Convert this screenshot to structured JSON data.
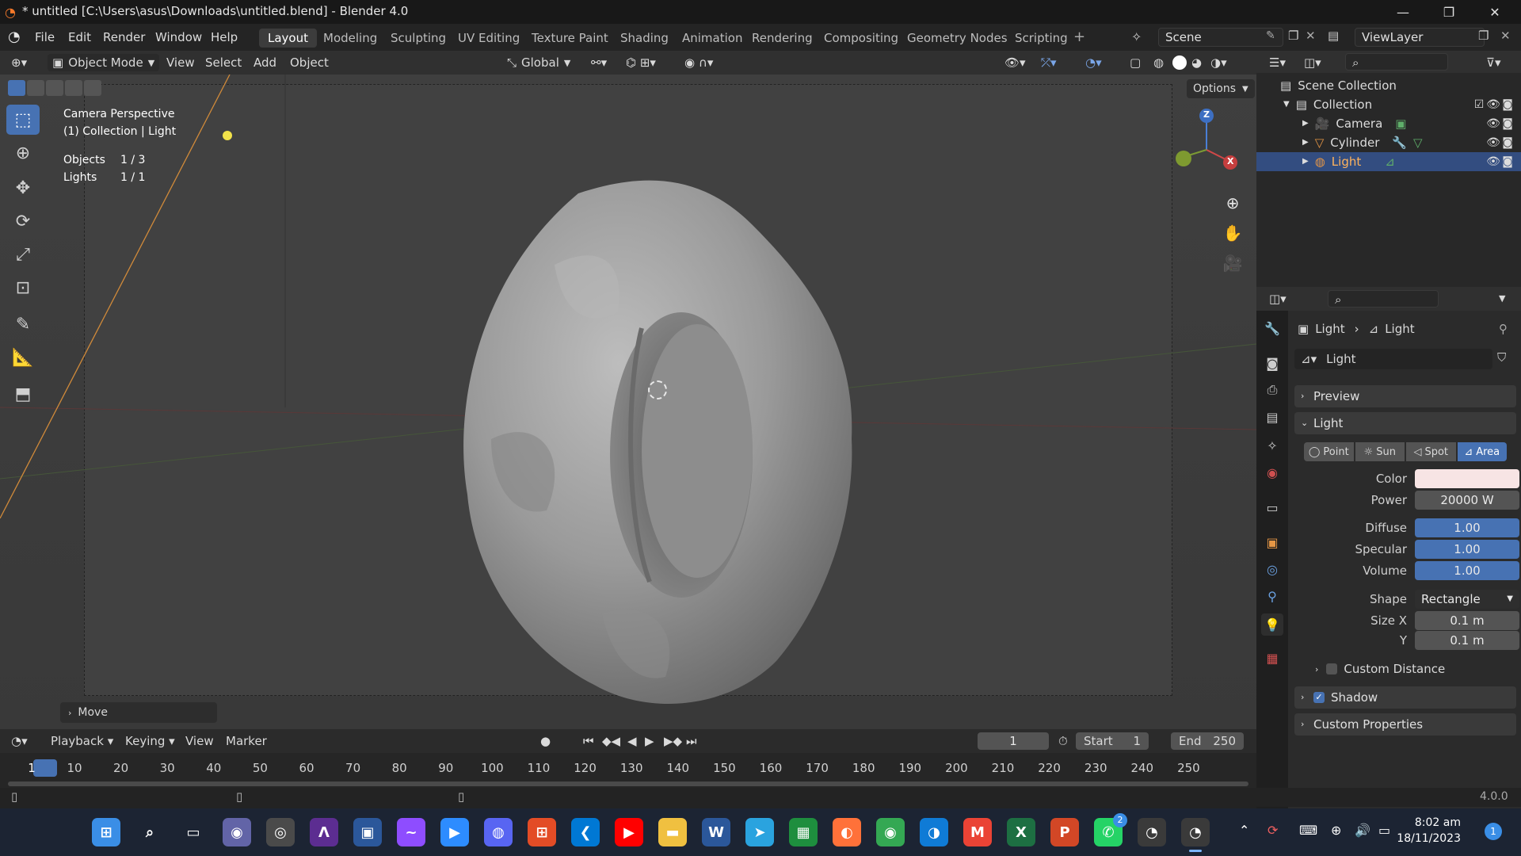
{
  "window": {
    "title": "* untitled [C:\\Users\\asus\\Downloads\\untitled.blend] - Blender 4.0",
    "minimize": "—",
    "maximize": "❐",
    "close": "✕"
  },
  "menu": [
    "File",
    "Edit",
    "Render",
    "Window",
    "Help"
  ],
  "workspaces": [
    {
      "label": "Layout",
      "active": true
    },
    {
      "label": "Modeling"
    },
    {
      "label": "Sculpting"
    },
    {
      "label": "UV Editing"
    },
    {
      "label": "Texture Paint"
    },
    {
      "label": "Shading"
    },
    {
      "label": "Animation"
    },
    {
      "label": "Rendering"
    },
    {
      "label": "Compositing"
    },
    {
      "label": "Geometry Nodes"
    },
    {
      "label": "Scripting"
    }
  ],
  "add_workspace": "+",
  "scene": {
    "name": "Scene"
  },
  "view_layer": {
    "name": "ViewLayer"
  },
  "viewport": {
    "mode": "Object Mode",
    "menus": [
      "View",
      "Select",
      "Add",
      "Object"
    ],
    "transform_orientation": "Global",
    "options_label": "Options",
    "overlay": {
      "line1": "Camera Perspective",
      "line2": "(1) Collection | Light",
      "stats": [
        {
          "label": "Objects",
          "value": "1 / 3"
        },
        {
          "label": "Lights",
          "value": "1 / 1"
        }
      ]
    },
    "last_operator": "Move",
    "gizmo": {
      "z": "Z",
      "x": "X"
    }
  },
  "outliner": {
    "root": "Scene Collection",
    "collection": "Collection",
    "items": [
      {
        "name": "Camera",
        "selected": false
      },
      {
        "name": "Cylinder",
        "selected": false
      },
      {
        "name": "Light",
        "selected": true
      }
    ]
  },
  "properties": {
    "breadcrumb": [
      "Light",
      "Light"
    ],
    "datablock": "Light",
    "panels": {
      "preview": "Preview",
      "light": "Light",
      "custom_distance": "Custom Distance",
      "shadow": "Shadow",
      "custom_properties": "Custom Properties"
    },
    "light_types": [
      "Point",
      "Sun",
      "Spot",
      "Area"
    ],
    "active_type": "Area",
    "color": {
      "label": "Color",
      "value": "#f7e4e4"
    },
    "power": {
      "label": "Power",
      "value": "20000 W"
    },
    "diffuse": {
      "label": "Diffuse",
      "value": "1.00"
    },
    "specular": {
      "label": "Specular",
      "value": "1.00"
    },
    "volume": {
      "label": "Volume",
      "value": "1.00"
    },
    "shape": {
      "label": "Shape",
      "value": "Rectangle"
    },
    "size_x": {
      "label": "Size X",
      "value": "0.1 m"
    },
    "size_y": {
      "label": "Y",
      "value": "0.1 m"
    }
  },
  "timeline": {
    "menus": [
      "Playback",
      "Keying",
      "View",
      "Marker"
    ],
    "current_frame": "1",
    "start_label": "Start",
    "start": "1",
    "end_label": "End",
    "end": "250",
    "frames": [
      "1",
      "10",
      "20",
      "30",
      "40",
      "50",
      "60",
      "70",
      "80",
      "90",
      "100",
      "110",
      "120",
      "130",
      "140",
      "150",
      "160",
      "170",
      "180",
      "190",
      "200",
      "210",
      "220",
      "230",
      "240",
      "250"
    ]
  },
  "statusbar": {
    "version": "4.0.0"
  },
  "taskbar": {
    "time": "8:02 am",
    "date": "18/11/2023",
    "whatsapp_badge": "2",
    "notification_badge": "1",
    "apps": [
      {
        "name": "windows-start-icon",
        "color": "#3a8ee6",
        "glyph": "⊞"
      },
      {
        "name": "search-icon",
        "color": "transparent",
        "glyph": "⌕"
      },
      {
        "name": "task-view-icon",
        "color": "transparent",
        "glyph": "▭"
      },
      {
        "name": "chat-icon",
        "color": "#6264a7",
        "glyph": "◉"
      },
      {
        "name": "camera-app-icon",
        "color": "#4a4a4a",
        "glyph": "◎"
      },
      {
        "name": "vs-icon",
        "color": "#5c2d91",
        "glyph": "ᐱ"
      },
      {
        "name": "store-icon",
        "color": "#2b579a",
        "glyph": "▣"
      },
      {
        "name": "messenger-icon",
        "color": "#8e4dff",
        "glyph": "~"
      },
      {
        "name": "zoom-icon",
        "color": "#2d8cff",
        "glyph": "▶"
      },
      {
        "name": "discord-icon",
        "color": "#5865f2",
        "glyph": "◍"
      },
      {
        "name": "ms-store-icon",
        "color": "#e34c26",
        "glyph": "⊞"
      },
      {
        "name": "vscode-icon",
        "color": "#0078d4",
        "glyph": "❮"
      },
      {
        "name": "youtube-icon",
        "color": "#ff0000",
        "glyph": "▶"
      },
      {
        "name": "file-explorer-icon",
        "color": "#f0c040",
        "glyph": "▬"
      },
      {
        "name": "word-icon",
        "color": "#2b579a",
        "glyph": "W"
      },
      {
        "name": "telegram-icon",
        "color": "#2aa3df",
        "glyph": "➤"
      },
      {
        "name": "classroom-icon",
        "color": "#1e8e3e",
        "glyph": "▦"
      },
      {
        "name": "firefox-icon",
        "color": "#ff7139",
        "glyph": "◐"
      },
      {
        "name": "chrome-icon",
        "color": "#34a853",
        "glyph": "◉"
      },
      {
        "name": "edge-icon",
        "color": "#0f7bd6",
        "glyph": "◑"
      },
      {
        "name": "gmail-icon",
        "color": "#ea4335",
        "glyph": "M"
      },
      {
        "name": "excel-icon",
        "color": "#1d6f42",
        "glyph": "X"
      },
      {
        "name": "powerpoint-icon",
        "color": "#d24726",
        "glyph": "P"
      },
      {
        "name": "whatsapp-icon",
        "color": "#25d366",
        "glyph": "✆"
      },
      {
        "name": "blender-icon",
        "color": "#3a3a3a",
        "glyph": "◔"
      },
      {
        "name": "blender-active-icon",
        "color": "#3a3a3a",
        "glyph": "◔"
      }
    ]
  }
}
